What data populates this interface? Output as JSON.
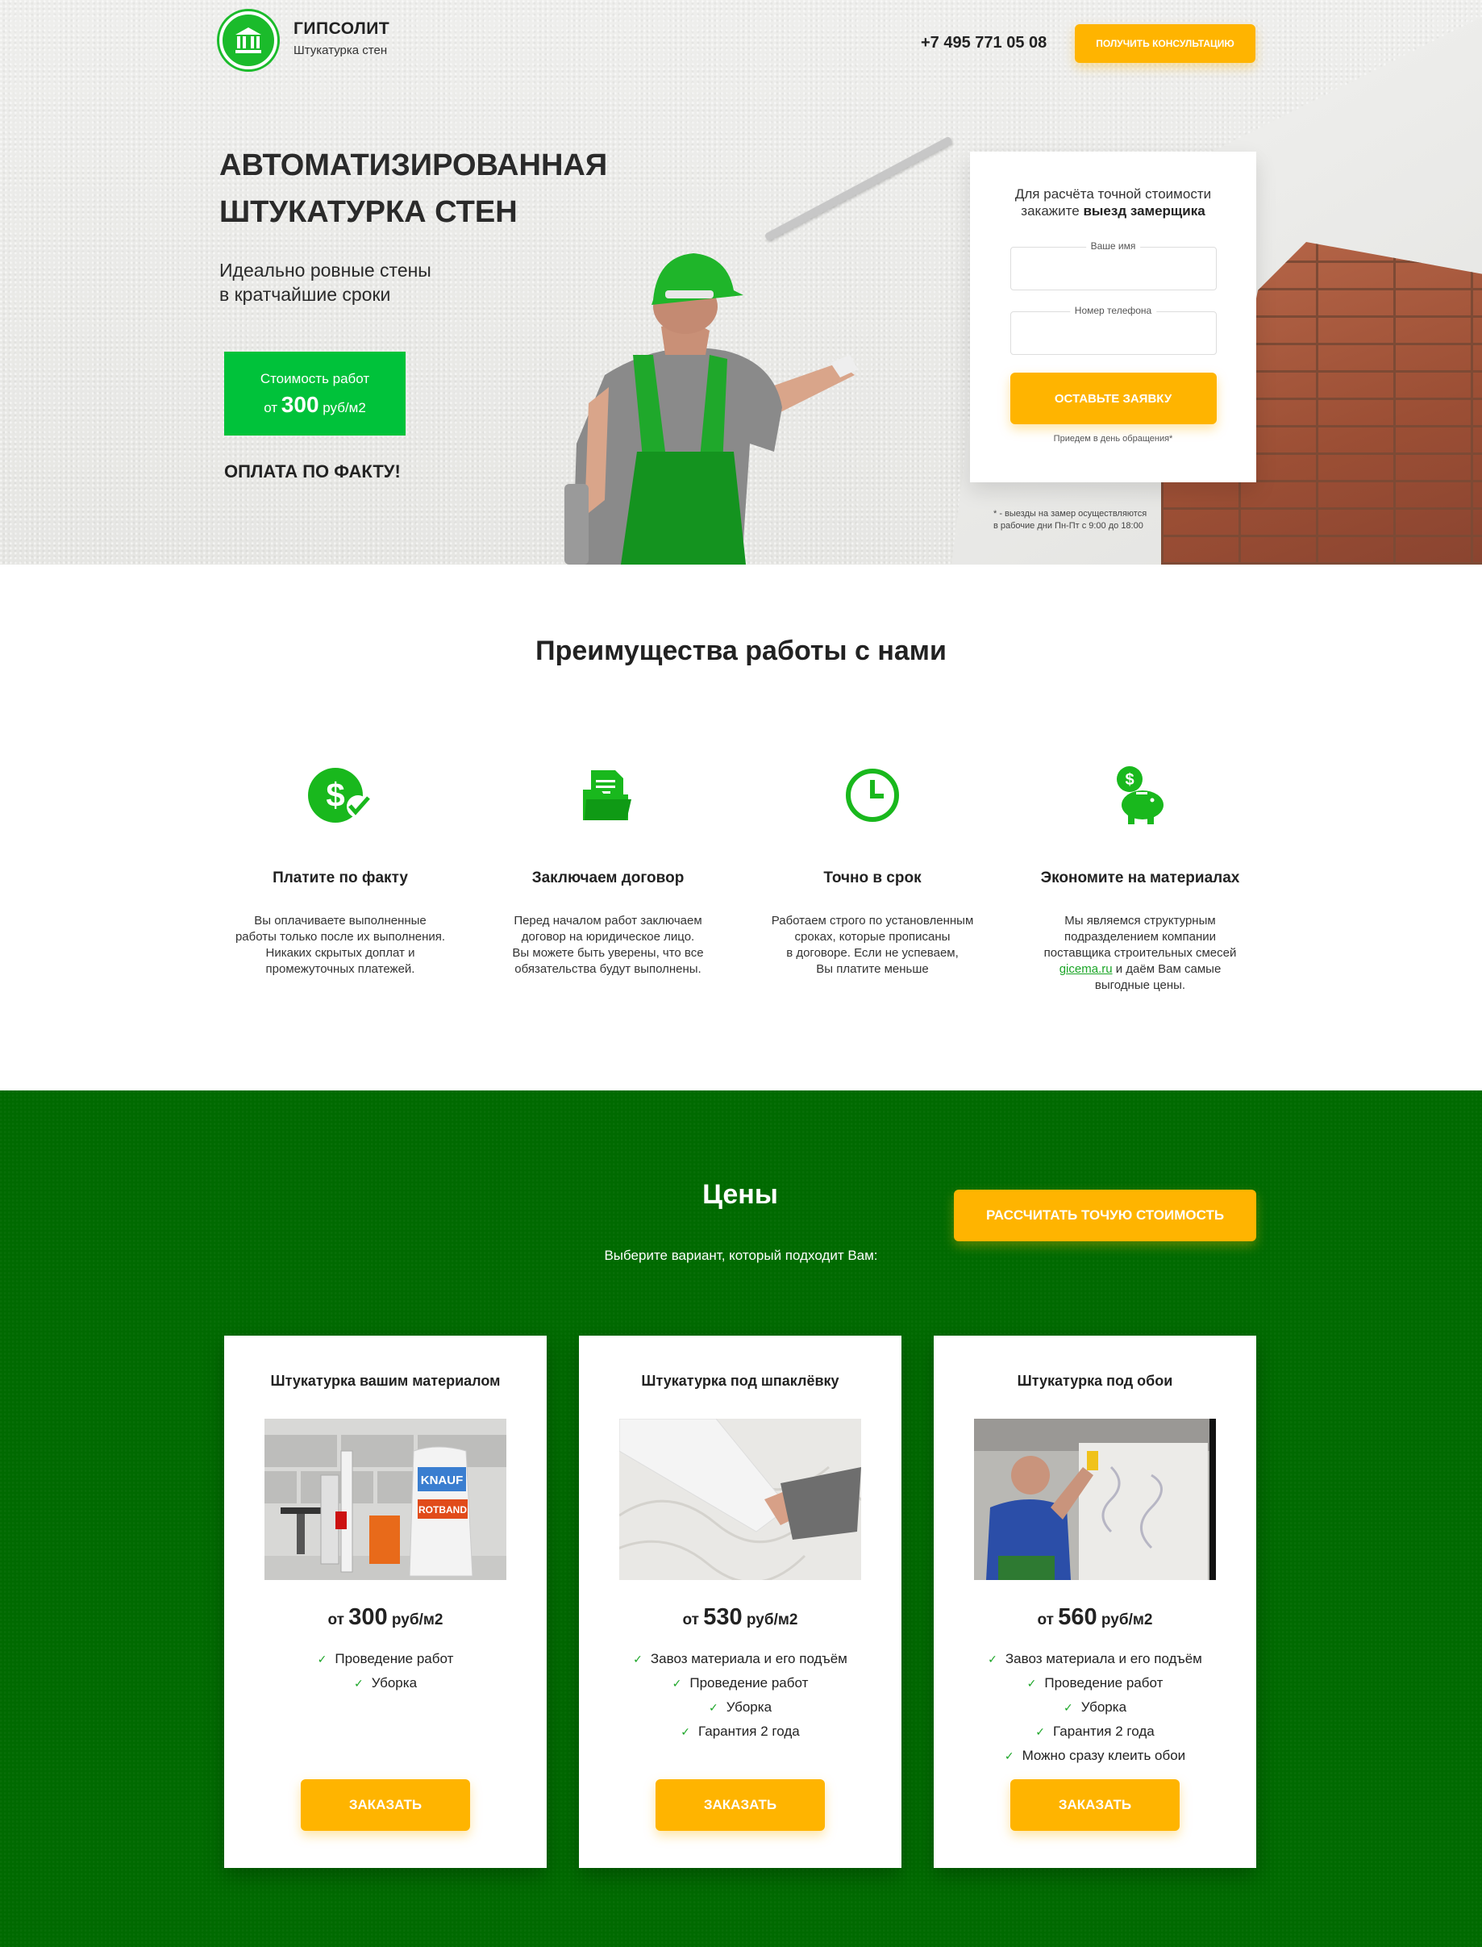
{
  "header": {
    "brand_name": "ГИПСОЛИТ",
    "brand_sub": "Штукатурка стен",
    "phone": "+7 495 771 05 08",
    "consult_button": "ПОЛУЧИТЬ КОНСУЛЬТАЦИЮ"
  },
  "hero": {
    "title": "АВТОМАТИЗИРОВАННАЯ ШТУКАТУРКА СТЕН",
    "subtitle_line1": "Идеально ровные стены",
    "subtitle_line2": "в кратчайшие сроки",
    "price_label": "Стоимость работ",
    "price_prefix": "от",
    "price_value": "300",
    "price_unit": "руб/м2",
    "pay_fact": "ОПЛАТА ПО ФАКТУ!"
  },
  "form": {
    "title_line1": "Для расчёта точной стоимости",
    "title_line2_prefix": "закажите",
    "title_line2_bold": "выезд замерщика",
    "name_label": "Ваше имя",
    "phone_label": "Номер телефона",
    "submit": "ОСТАВЬТЕ ЗАЯВКУ",
    "note": "Приедем в день обращения*",
    "visit_note_line1": "* - выезды на замер осуществляются",
    "visit_note_line2": "в рабочие дни Пн-Пт с 9:00 до 18:00"
  },
  "advantages": {
    "title": "Преимущества работы с нами",
    "items": [
      {
        "icon": "dollar-check-icon",
        "title": "Платите по факту",
        "lines": [
          "Вы оплачиваете выполненные",
          "работы только после их выполнения.",
          "Никаких скрытых доплат и",
          "промежуточных платежей."
        ]
      },
      {
        "icon": "contract-folder-icon",
        "title": "Заключаем договор",
        "lines": [
          "Перед началом работ заключаем",
          "договор на юридическое лицо.",
          "Вы можете быть уверены, что все",
          "обязательства будут выполнены."
        ]
      },
      {
        "icon": "clock-icon",
        "title": "Точно в срок",
        "lines": [
          "Работаем строго по установленным",
          "сроках, которые прописаны",
          "в договоре. Если не успеваем,",
          "Вы платите меньше"
        ]
      },
      {
        "icon": "piggy-bank-icon",
        "title": "Экономите на материалах",
        "lines": [
          "Мы являемся структурным",
          "подразделением компании",
          "поставщика строительных смесей"
        ],
        "link": "gicema.ru",
        "after_link": " и даём Вам самые",
        "last_line": "выгодные цены."
      }
    ]
  },
  "prices": {
    "title": "Цены",
    "subtitle": "Выберите вариант, который подходит Вам:",
    "calc_button": "РАССЧИТАТЬ ТОЧУЮ СТОИМОСТЬ",
    "cards": [
      {
        "title": "Штукатурка вашим материалом",
        "prefix": "от",
        "value": "300",
        "unit": "руб/м2",
        "features": [
          "Проведение работ",
          "Уборка"
        ],
        "button": "ЗАКАЗАТЬ",
        "photo_text": "ROTBAND",
        "photo_brand": "KNAUF"
      },
      {
        "title": "Штукатурка под шпаклёвку",
        "prefix": "от",
        "value": "530",
        "unit": "руб/м2",
        "features": [
          "Завоз материала и его подъём",
          "Проведение работ",
          "Уборка",
          "Гарантия 2 года"
        ],
        "button": "ЗАКАЗАТЬ"
      },
      {
        "title": "Штукатурка под обои",
        "prefix": "от",
        "value": "560",
        "unit": "руб/м2",
        "features": [
          "Завоз материала и его подъём",
          "Проведение работ",
          "Уборка",
          "Гарантия 2 года",
          "Можно сразу клеить обои"
        ],
        "button": "ЗАКАЗАТЬ"
      }
    ]
  },
  "colors": {
    "green": "#00c23a",
    "dark_green": "#006a00",
    "yellow": "#ffb400",
    "icon_green": "#19b81d"
  }
}
